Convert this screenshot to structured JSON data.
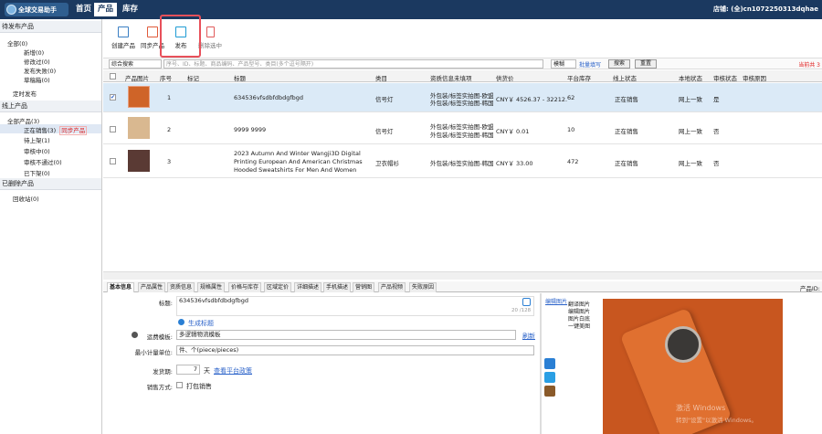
{
  "header": {
    "logo_text": "全球交易助手",
    "nav": [
      "首页",
      "产品",
      "库存"
    ],
    "store": "店铺: (全)cn1072250313dqhae"
  },
  "sidebar": {
    "pending": {
      "title": "待发布产品",
      "items": [
        "全部(0)",
        "新增(0)",
        "修改过(0)",
        "发布失败(0)",
        "草稿箱(0)",
        "定时发布"
      ]
    },
    "online": {
      "title": "线上产品",
      "items": [
        "全部产品(3)",
        "正在销售(3)",
        "待上架(1)",
        "审核中(0)",
        "审核不通过(0)",
        "已下架(0)"
      ],
      "sync_label": "同步产品"
    },
    "deleted": {
      "title": "已删除产品",
      "items": [
        "回收站(0)"
      ]
    }
  },
  "toolbar": {
    "create": "创建产品",
    "sync": "同步产品",
    "publish": "发布",
    "delete": "删除选中"
  },
  "filter": {
    "search_type": "综合搜索",
    "search_placeholder": "序号、ID、标题、商品编码、产品型号、类目(多个逗号隔开)",
    "mode": "模糊",
    "batch": "批量填写",
    "search_btn": "搜索",
    "reset_btn": "重置",
    "pager": "当前共 3"
  },
  "columns": [
    "产品图片",
    "序号",
    "标记",
    "标题",
    "类目",
    "资质信息未填项",
    "供货价",
    "平台库存",
    "线上状态",
    "本地状态",
    "审核状态",
    "审核原因"
  ],
  "rows": [
    {
      "no": "1",
      "title": "634536vfsdbfdbdgfbgd",
      "title2": "",
      "title3": "",
      "cat": "信号灯",
      "q1": "外包装/标签实拍图-欧盟",
      "q2": "外包装/标签实拍图-韩国",
      "price": "CNY￥ 4526.37 - 32212.",
      "stock": "62",
      "online": "正在销售",
      "local": "网上一致",
      "audit": "是",
      "checked": "✔"
    },
    {
      "no": "2",
      "title": "9999  9999",
      "title2": "",
      "title3": "",
      "cat": "信号灯",
      "q1": "外包装/标签实拍图-欧盟",
      "q2": "外包装/标签实拍图-韩国",
      "price": "CNY￥ 0.01",
      "stock": "10",
      "online": "正在销售",
      "local": "网上一致",
      "audit": "否",
      "checked": ""
    },
    {
      "no": "3",
      "title": "2023 Autumn And Winter Wangji3D Digital",
      "title2": "Printing European And American Christmas",
      "title3": "Hooded Sweatshirts For Men And Women",
      "cat": "卫衣帽衫",
      "q1": "外包装/标签实拍图-韩国",
      "q2": "",
      "price": "CNY￥ 33.00",
      "stock": "472",
      "online": "正在销售",
      "local": "网上一致",
      "audit": "否",
      "checked": ""
    }
  ],
  "tabs": [
    "基本信息",
    "产品属性",
    "资质信息",
    "规格属性",
    "价格与库存",
    "区域定价",
    "详细描述",
    "手机描述",
    "营销图",
    "产品视频",
    "失败原因"
  ],
  "product_id_label": "产品ID:",
  "form": {
    "title_label": "标题:",
    "title_value": "634536vfsdbfdbdgfbgd",
    "title_count": "20 /128",
    "gen_title": "生成标题",
    "shipping_label": "运费模板:",
    "shipping_value": "多逻辑物流模板",
    "refresh": "刷新",
    "unit_label": "最小计量单位:",
    "unit_value": "件、个(piece/pieces)",
    "delivery_label": "发货期:",
    "delivery_value": "7",
    "delivery_unit": "天",
    "view_policy": "查看平台政策",
    "sale_label": "销售方式:",
    "sale_value": "打包销售"
  },
  "image_menu": {
    "edit_link": "编辑图片",
    "items": [
      "翻译图片",
      "编辑图片",
      "图片白底",
      "一键美图"
    ]
  },
  "watermark": {
    "line1": "激活 Windows",
    "line2": "转到\"设置\"以激活 Windows。"
  }
}
